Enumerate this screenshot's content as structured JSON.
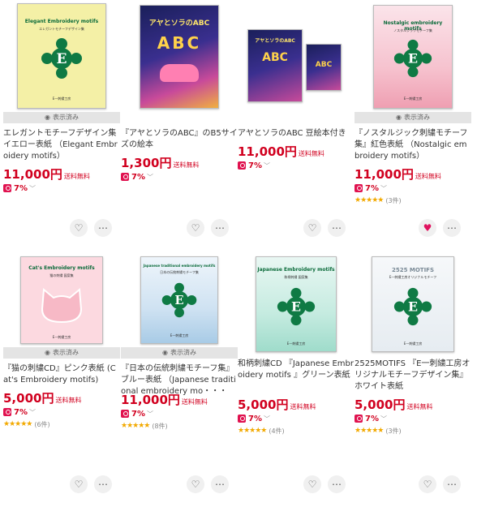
{
  "seen_label": "表示済み",
  "products": [
    {
      "cover_title": "Elegant Embroidery motifs",
      "cover_sub": "エレガントモチーフデザイン集",
      "cover_pub": "E一刺繍工房",
      "title": "エレガントモチーフデザイン集 イエロー表紙 （Elegant Embroidery motifs）",
      "price": "11,000円",
      "shipping": "送料無料",
      "points": "7%",
      "rating": "",
      "count": "",
      "favorited": false
    },
    {
      "cover_title": "アヤとソラのABC",
      "cover_sub": "",
      "cover_pub": "",
      "title": "『アヤとソラのABC』のB5サイズの絵本",
      "price": "1,300円",
      "shipping": "送料無料",
      "points": "7%",
      "rating": "",
      "count": "",
      "favorited": false
    },
    {
      "cover_title": "アヤとソラのABC",
      "cover_sub": "",
      "cover_pub": "",
      "title": "アヤとソラのABC 豆絵本付き",
      "price": "11,000円",
      "shipping": "送料無料",
      "points": "7%",
      "rating": "",
      "count": "",
      "favorited": false
    },
    {
      "cover_title": "Nostalgic embroidery motifs",
      "cover_sub": "ノスタルジックモチーフ集",
      "cover_pub": "E一刺繍工房",
      "title": "『ノスタルジック刺繍モチーフ集』紅色表紙 （Nostalgic embroidery motifs）",
      "price": "11,000円",
      "shipping": "送料無料",
      "points": "7%",
      "rating": "★★★★★",
      "count": "(3件)",
      "favorited": true
    },
    {
      "cover_title": "Cat's Embroidery motifs",
      "cover_sub": "猫の刺繍 図案集",
      "cover_pub": "E一刺繍工房",
      "title": "『猫の刺繍CD』ピンク表紙 (Cat's Embroidery motifs)",
      "price": "5,000円",
      "shipping": "送料無料",
      "points": "7%",
      "rating": "★★★★★",
      "count": "(6件)",
      "favorited": false
    },
    {
      "cover_title": "Japanese traditional embroidery motifs",
      "cover_sub": "日本の伝統刺繍モチーフ集",
      "cover_pub": "E一刺繍工房",
      "title": "『日本の伝統刺繍モチーフ集』ブルー表紙 （Japanese traditional embroidery mo・・・",
      "price": "11,000円",
      "shipping": "送料無料",
      "points": "7%",
      "rating": "★★★★★",
      "count": "(8件)",
      "favorited": false
    },
    {
      "cover_title": "Japanese Embroidery motifs",
      "cover_sub": "和柄刺繍 図案集",
      "cover_pub": "E一刺繍工房",
      "title": "和柄刺繍CD 『Japanese Embroidery motifs 』グリーン表紙",
      "price": "5,000円",
      "shipping": "送料無料",
      "points": "7%",
      "rating": "★★★★★",
      "count": "(4件)",
      "favorited": false
    },
    {
      "cover_title": "2525 MOTIFS",
      "cover_sub": "E一刺繍工房オリジナルモチーフ",
      "cover_pub": "E一刺繍工房",
      "title": "2525MOTIFS 『E一刺繍工房オリジナルモチーフデザイン集』ホワイト表紙",
      "price": "5,000円",
      "shipping": "送料無料",
      "points": "7%",
      "rating": "★★★★★",
      "count": "(3件)",
      "favorited": false
    }
  ]
}
